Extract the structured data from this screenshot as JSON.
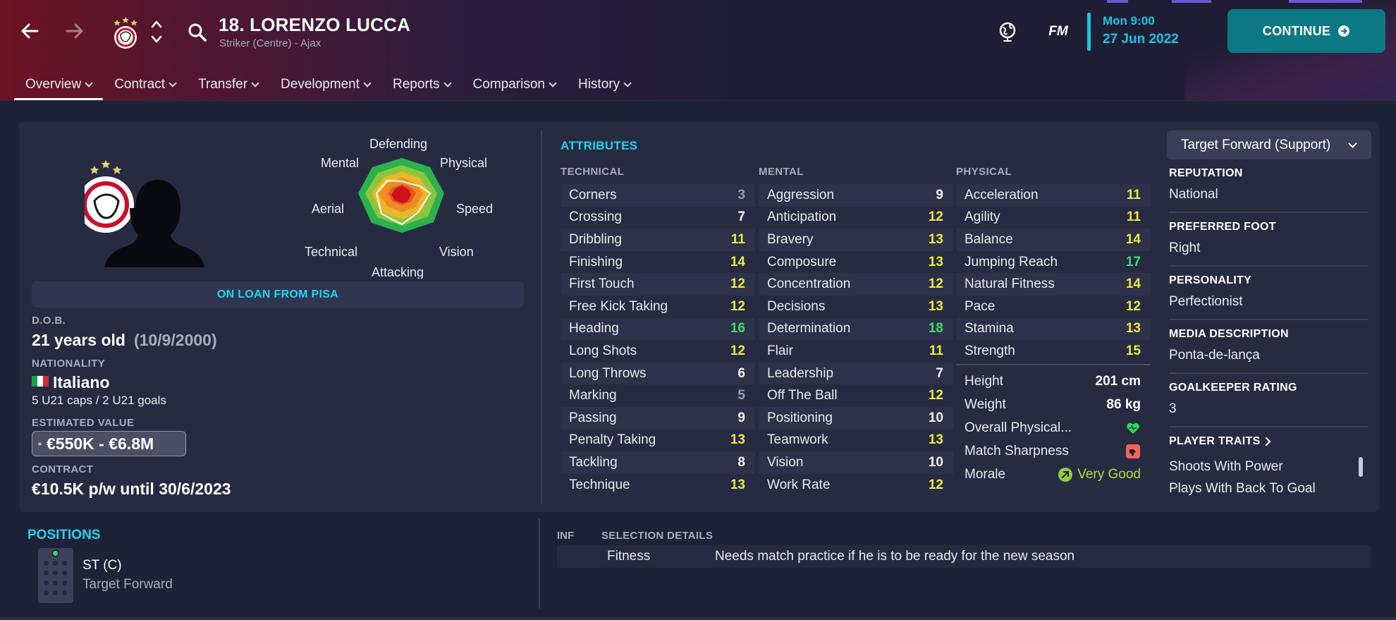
{
  "header": {
    "player_title": "18. LORENZO LUCCA",
    "player_subtitle": "Striker (Centre) - Ajax",
    "fm_label": "FM",
    "time": "Mon 9:00",
    "date": "27 Jun 2022",
    "continue_label": "CONTINUE"
  },
  "tabs": [
    {
      "label": "Overview",
      "active": true
    },
    {
      "label": "Contract"
    },
    {
      "label": "Transfer"
    },
    {
      "label": "Development"
    },
    {
      "label": "Reports"
    },
    {
      "label": "Comparison"
    },
    {
      "label": "History"
    }
  ],
  "radar": {
    "labels": {
      "defending": "Defending",
      "physical": "Physical",
      "speed": "Speed",
      "vision": "Vision",
      "attacking": "Attacking",
      "technical": "Technical",
      "aerial": "Aerial",
      "mental": "Mental"
    }
  },
  "profile": {
    "loan_banner": "ON LOAN FROM PISA",
    "dob_label": "D.O.B.",
    "age": "21 years old",
    "dob": "(10/9/2000)",
    "nationality_label": "NATIONALITY",
    "nationality": "Italiano",
    "caps": "5 U21 caps / 2 U21 goals",
    "value_label": "ESTIMATED VALUE",
    "value": "€550K - €6.8M",
    "contract_label": "CONTRACT",
    "contract": "€10.5K p/w until 30/6/2023"
  },
  "attributes": {
    "title": "ATTRIBUTES",
    "technical_head": "TECHNICAL",
    "mental_head": "MENTAL",
    "physical_head": "PHYSICAL",
    "technical": [
      {
        "name": "Corners",
        "value": "3",
        "tone": "grey"
      },
      {
        "name": "Crossing",
        "value": "7",
        "tone": "white"
      },
      {
        "name": "Dribbling",
        "value": "11",
        "tone": "yellow"
      },
      {
        "name": "Finishing",
        "value": "14",
        "tone": "yellow"
      },
      {
        "name": "First Touch",
        "value": "12",
        "tone": "yellow"
      },
      {
        "name": "Free Kick Taking",
        "value": "12",
        "tone": "yellow"
      },
      {
        "name": "Heading",
        "value": "16",
        "tone": "green"
      },
      {
        "name": "Long Shots",
        "value": "12",
        "tone": "yellow"
      },
      {
        "name": "Long Throws",
        "value": "6",
        "tone": "white"
      },
      {
        "name": "Marking",
        "value": "5",
        "tone": "grey"
      },
      {
        "name": "Passing",
        "value": "9",
        "tone": "white"
      },
      {
        "name": "Penalty Taking",
        "value": "13",
        "tone": "yellow"
      },
      {
        "name": "Tackling",
        "value": "8",
        "tone": "white"
      },
      {
        "name": "Technique",
        "value": "13",
        "tone": "yellow"
      }
    ],
    "mental": [
      {
        "name": "Aggression",
        "value": "9",
        "tone": "white"
      },
      {
        "name": "Anticipation",
        "value": "12",
        "tone": "yellow"
      },
      {
        "name": "Bravery",
        "value": "13",
        "tone": "yellow"
      },
      {
        "name": "Composure",
        "value": "13",
        "tone": "yellow"
      },
      {
        "name": "Concentration",
        "value": "12",
        "tone": "yellow"
      },
      {
        "name": "Decisions",
        "value": "13",
        "tone": "yellow"
      },
      {
        "name": "Determination",
        "value": "18",
        "tone": "green"
      },
      {
        "name": "Flair",
        "value": "11",
        "tone": "yellow"
      },
      {
        "name": "Leadership",
        "value": "7",
        "tone": "white"
      },
      {
        "name": "Off The Ball",
        "value": "12",
        "tone": "yellow"
      },
      {
        "name": "Positioning",
        "value": "10",
        "tone": "white"
      },
      {
        "name": "Teamwork",
        "value": "13",
        "tone": "yellow"
      },
      {
        "name": "Vision",
        "value": "10",
        "tone": "white"
      },
      {
        "name": "Work Rate",
        "value": "12",
        "tone": "yellow"
      }
    ],
    "physical": [
      {
        "name": "Acceleration",
        "value": "11",
        "tone": "yellow"
      },
      {
        "name": "Agility",
        "value": "11",
        "tone": "yellow"
      },
      {
        "name": "Balance",
        "value": "14",
        "tone": "yellow"
      },
      {
        "name": "Jumping Reach",
        "value": "17",
        "tone": "green"
      },
      {
        "name": "Natural Fitness",
        "value": "14",
        "tone": "yellow"
      },
      {
        "name": "Pace",
        "value": "12",
        "tone": "yellow"
      },
      {
        "name": "Stamina",
        "value": "13",
        "tone": "yellow"
      },
      {
        "name": "Strength",
        "value": "15",
        "tone": "yellow"
      }
    ],
    "height_label": "Height",
    "height": "201 cm",
    "weight_label": "Weight",
    "weight": "86 kg",
    "overall_physical_label": "Overall Physical...",
    "match_sharpness_label": "Match Sharpness",
    "morale_label": "Morale",
    "morale": "Very Good"
  },
  "side": {
    "role": "Target Forward (Support)",
    "reputation_label": "REPUTATION",
    "reputation": "National",
    "foot_label": "PREFERRED FOOT",
    "foot": "Right",
    "personality_label": "PERSONALITY",
    "personality": "Perfectionist",
    "media_label": "MEDIA DESCRIPTION",
    "media": "Ponta-de-lança",
    "gk_label": "GOALKEEPER RATING",
    "gk": "3",
    "traits_label": "PLAYER TRAITS",
    "traits": [
      "Shoots With Power",
      "Plays With Back To Goal"
    ]
  },
  "bottom": {
    "positions_title": "POSITIONS",
    "position": "ST (C)",
    "position_role": "Target Forward",
    "inf_head": "INF",
    "selection_head": "SELECTION DETAILS",
    "selection_key": "Fitness",
    "selection_value": "Needs match practice if he is to be ready for the new season"
  },
  "colors": {
    "accent": "#1ed4f1",
    "continue": "#0c7883",
    "attr_green": "#3bdc6b",
    "attr_yellow": "#ecea3f"
  }
}
